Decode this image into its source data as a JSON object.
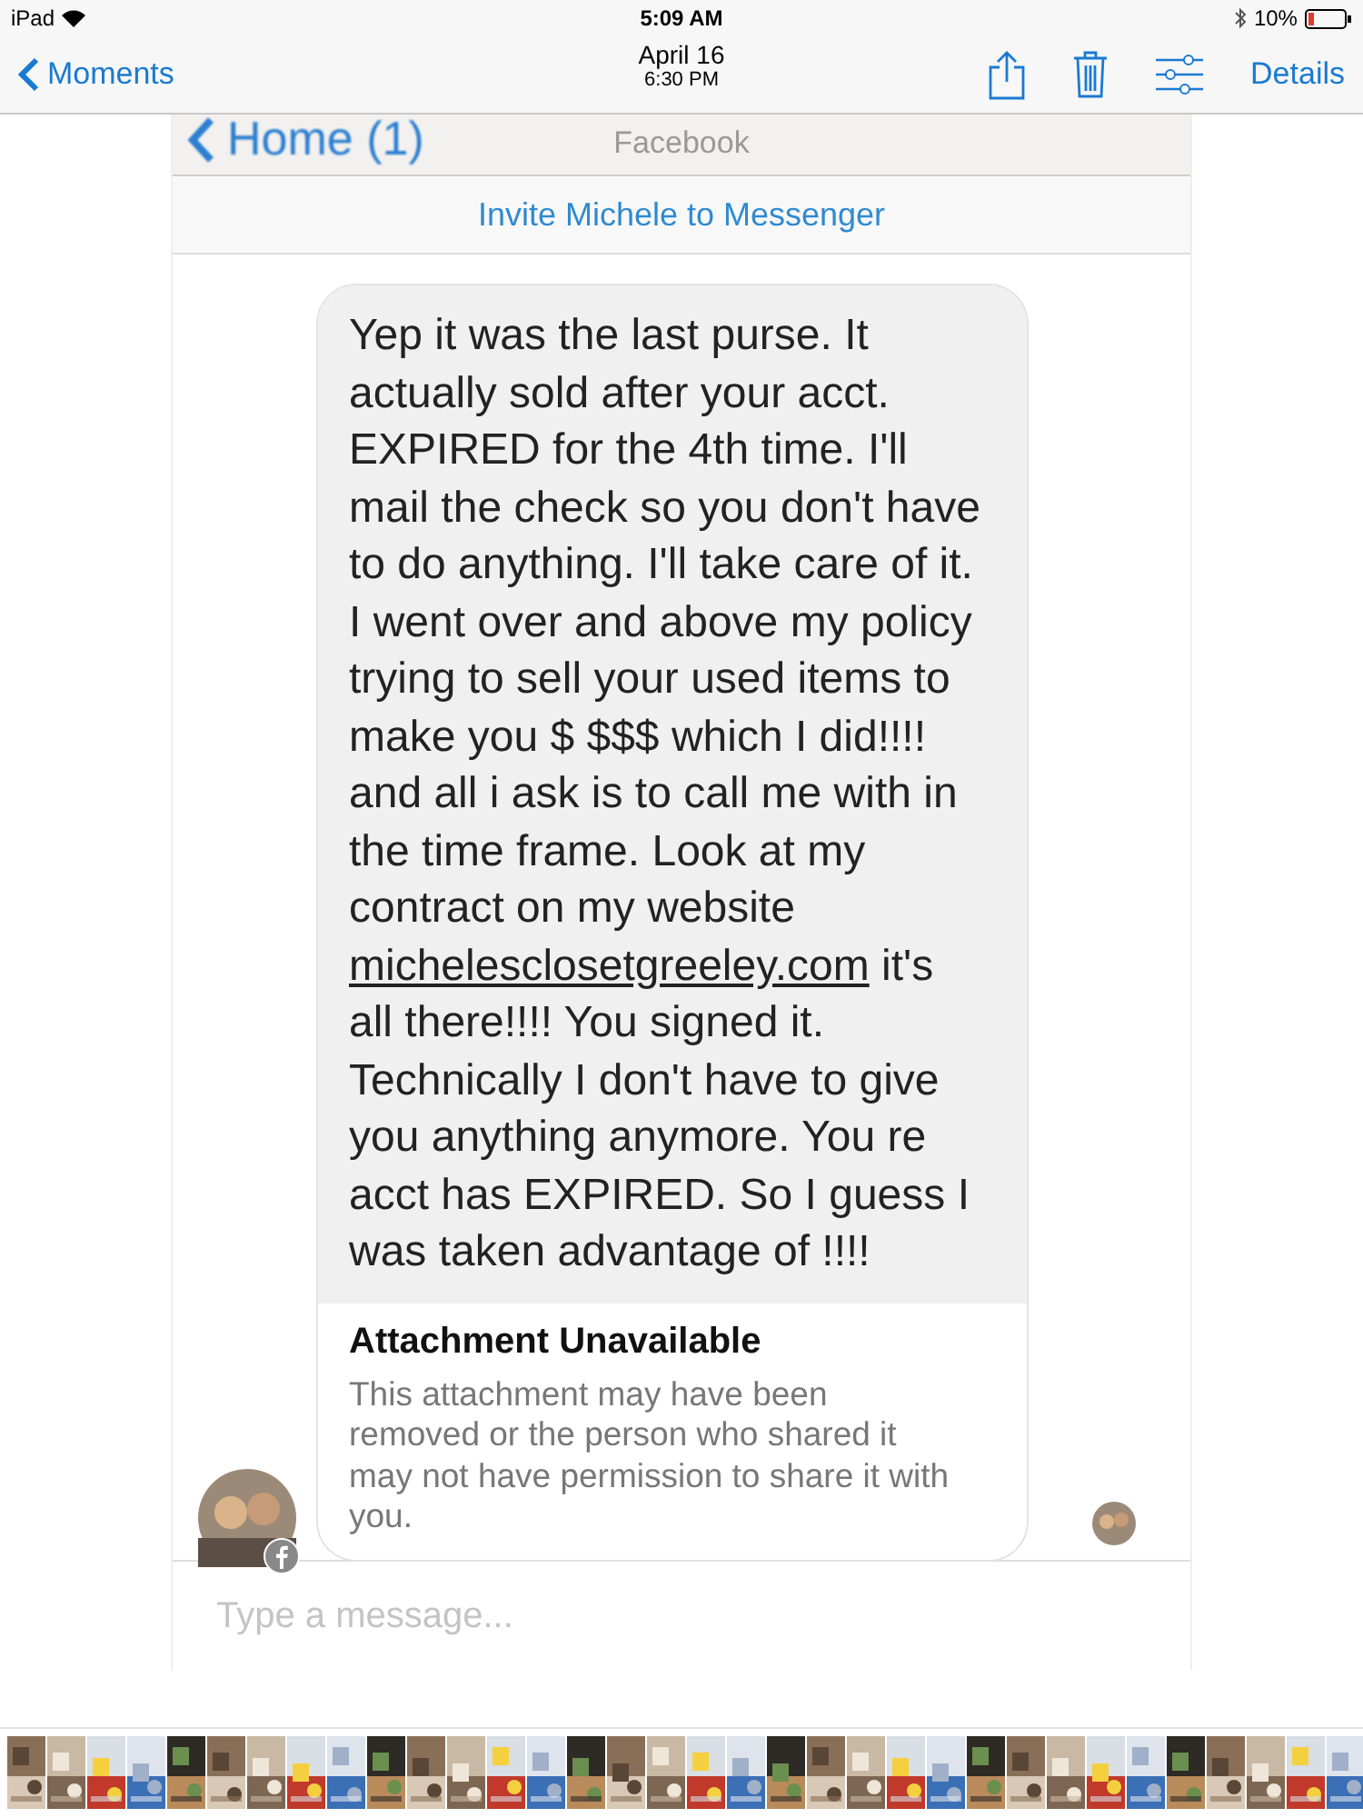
{
  "status_bar": {
    "device": "iPad",
    "time": "5:09 AM",
    "battery": "10%"
  },
  "nav_bar": {
    "back": "Moments",
    "date": "April 16",
    "time": "6:30 PM",
    "details": "Details"
  },
  "screenshot": {
    "header": {
      "back": "Home (1)",
      "title": "Facebook"
    },
    "invite": "Invite Michele to Messenger",
    "message": {
      "before": "Yep it was the last purse. It actually sold after your acct. EXPIRED for the 4th time.  I'll mail the check so you don't have to do anything. I'll take care of it. I went over and above my policy trying to sell your used items to make you $ $$$ which I did!!!! and all i ask is to call me with in the time frame. Look at my contract on my  website ",
      "link": "michelesclosetgreeley.com",
      "after": " it's all there!!!! You signed it. Technically I don't have to give you anything anymore. You re acct has EXPIRED. So I guess I was taken advantage of !!!!"
    },
    "attachment": {
      "title": "Attachment Unavailable",
      "text": "This attachment may have been removed or the person who shared it may not have permission to share it with you."
    },
    "composer": {
      "placeholder": "Type a message..."
    }
  }
}
